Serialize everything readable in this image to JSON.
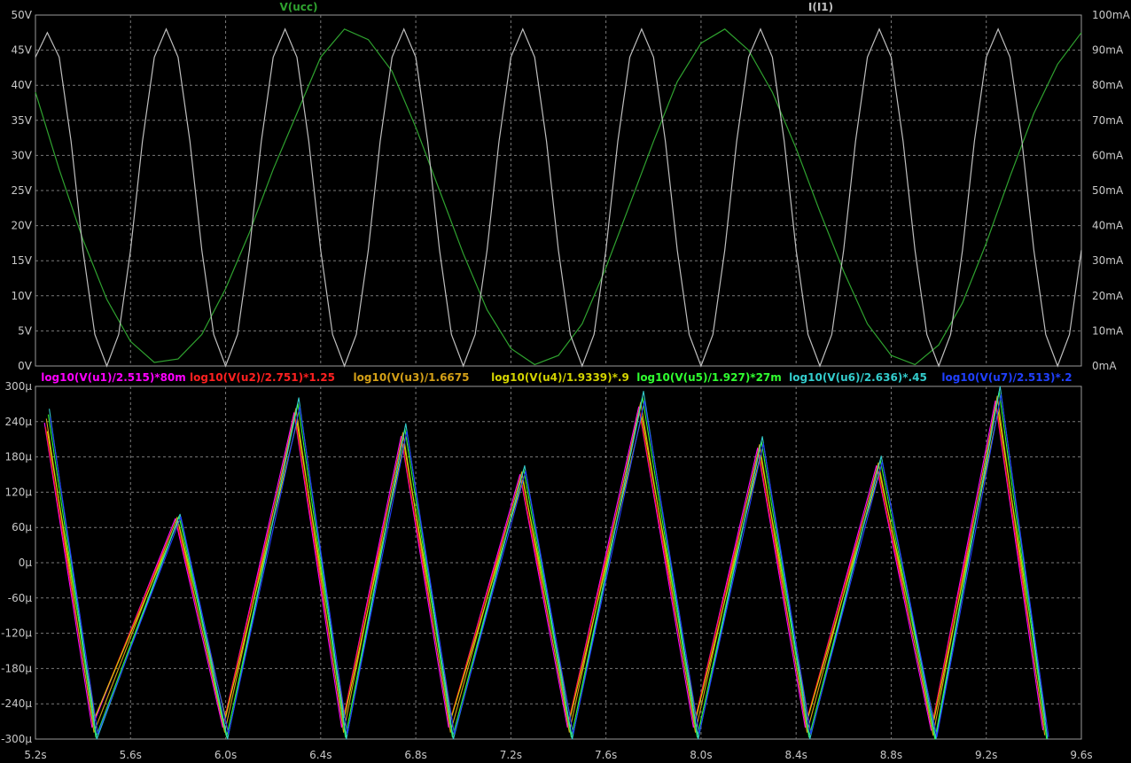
{
  "chart_data": [
    {
      "type": "line",
      "panel": "top",
      "xlim": [
        5.2,
        9.6
      ],
      "x_ticks": [
        "5.2s",
        "5.6s",
        "6.0s",
        "6.4s",
        "6.8s",
        "7.2s",
        "7.6s",
        "8.0s",
        "8.4s",
        "8.8s",
        "9.2s",
        "9.6s"
      ],
      "left_axis": {
        "ylim": [
          0,
          50
        ],
        "ticks": [
          "0V",
          "5V",
          "10V",
          "15V",
          "20V",
          "25V",
          "30V",
          "35V",
          "40V",
          "45V",
          "50V"
        ]
      },
      "right_axis": {
        "ylim": [
          0,
          100
        ],
        "ticks": [
          "0mA",
          "10mA",
          "20mA",
          "30mA",
          "40mA",
          "50mA",
          "60mA",
          "70mA",
          "80mA",
          "90mA",
          "100mA"
        ]
      },
      "grid": true,
      "series": [
        {
          "name": "V(ucc)",
          "color": "#2fa22f",
          "axis": "left",
          "x": [
            5.2,
            5.3,
            5.4,
            5.5,
            5.6,
            5.7,
            5.8,
            5.9,
            6.0,
            6.1,
            6.2,
            6.3,
            6.4,
            6.5,
            6.6,
            6.7,
            6.8,
            6.9,
            7.0,
            7.1,
            7.2,
            7.3,
            7.4,
            7.5,
            7.6,
            7.7,
            7.8,
            7.9,
            8.0,
            8.1,
            8.2,
            8.3,
            8.4,
            8.5,
            8.6,
            8.7,
            8.8,
            8.9,
            9.0,
            9.1,
            9.2,
            9.3,
            9.4,
            9.5,
            9.6
          ],
          "y": [
            39.0,
            28.0,
            18.0,
            9.5,
            3.5,
            0.5,
            1.0,
            4.5,
            11.0,
            19.0,
            28.0,
            36.0,
            44.0,
            48.0,
            46.5,
            42.0,
            34.0,
            25.0,
            16.0,
            8.0,
            2.5,
            0.2,
            1.5,
            6.0,
            14.0,
            23.0,
            32.0,
            40.5,
            46.0,
            48.0,
            45.0,
            39.0,
            31.0,
            22.0,
            13.5,
            6.0,
            1.5,
            0.2,
            3.0,
            9.0,
            17.5,
            27.0,
            36.0,
            43.0,
            47.5
          ]
        },
        {
          "name": "I(I1)",
          "color": "#bfbfbf",
          "axis": "right",
          "x": [
            5.2,
            5.25,
            5.3,
            5.35,
            5.4,
            5.45,
            5.5,
            5.55,
            5.6,
            5.65,
            5.7,
            5.75,
            5.8,
            5.85,
            5.9,
            5.95,
            6.0,
            6.05,
            6.1,
            6.15,
            6.2,
            6.25,
            6.3,
            6.35,
            6.4,
            6.45,
            6.5,
            6.55,
            6.6,
            6.65,
            6.7,
            6.75,
            6.8,
            6.85,
            6.9,
            6.95,
            7.0,
            7.05,
            7.1,
            7.15,
            7.2,
            7.25,
            7.3,
            7.35,
            7.4,
            7.45,
            7.5,
            7.55,
            7.6,
            7.65,
            7.7,
            7.75,
            7.8,
            7.85,
            7.9,
            7.95,
            8.0,
            8.05,
            8.1,
            8.15,
            8.2,
            8.25,
            8.3,
            8.35,
            8.4,
            8.45,
            8.5,
            8.55,
            8.6,
            8.65,
            8.7,
            8.75,
            8.8,
            8.85,
            8.9,
            8.95,
            9.0,
            9.05,
            9.1,
            9.15,
            9.2,
            9.25,
            9.3,
            9.35,
            9.4,
            9.45,
            9.5,
            9.55,
            9.6
          ],
          "y": [
            88,
            95,
            88,
            64,
            33,
            9,
            0,
            9,
            33,
            64,
            88,
            96,
            88,
            64,
            33,
            9,
            0,
            9,
            33,
            64,
            88,
            96,
            88,
            64,
            33,
            9,
            0,
            9,
            33,
            64,
            88,
            96,
            88,
            64,
            33,
            9,
            0,
            9,
            33,
            64,
            88,
            96,
            88,
            64,
            33,
            9,
            0,
            9,
            33,
            64,
            88,
            96,
            88,
            64,
            33,
            9,
            0,
            9,
            33,
            64,
            88,
            96,
            88,
            64,
            33,
            9,
            0,
            9,
            33,
            64,
            88,
            96,
            88,
            64,
            33,
            9,
            0,
            9,
            33,
            64,
            88,
            96,
            88,
            64,
            33,
            9,
            0,
            9,
            33
          ]
        }
      ]
    },
    {
      "type": "line",
      "panel": "bottom",
      "xlim": [
        5.2,
        9.6
      ],
      "x_ticks": [
        "5.2s",
        "5.6s",
        "6.0s",
        "6.4s",
        "6.8s",
        "7.2s",
        "7.6s",
        "8.0s",
        "8.4s",
        "8.8s",
        "9.2s",
        "9.6s"
      ],
      "ylim": [
        -300,
        300
      ],
      "y_ticks": [
        "-300µ",
        "-240µ",
        "-180µ",
        "-120µ",
        "-60µ",
        "0µ",
        "60µ",
        "120µ",
        "180µ",
        "240µ",
        "300µ"
      ],
      "grid": true,
      "peaks": {
        "x": [
          5.25,
          5.45,
          5.8,
          6.0,
          6.3,
          6.5,
          6.75,
          6.95,
          7.25,
          7.45,
          7.75,
          7.98,
          8.25,
          8.45,
          8.75,
          8.98,
          9.25,
          9.45
        ],
        "y": [
          238,
          -280,
          75,
          -280,
          255,
          -280,
          215,
          -280,
          150,
          -280,
          265,
          -280,
          195,
          -280,
          165,
          -285,
          275,
          -285
        ]
      },
      "series": [
        {
          "name": "log10(V(u1)/2.515)*80m",
          "color": "#ff00ff",
          "scale": 1.0
        },
        {
          "name": "log10(V(u2)/2.751)*1.25",
          "color": "#ff2020",
          "scale": 0.97
        },
        {
          "name": "log10(V(u3)/1.6675",
          "color": "#d4a017",
          "scale": 1.03
        },
        {
          "name": "log10(V(u4)/1.9339)*.9",
          "color": "#d4d400",
          "scale": 0.94
        },
        {
          "name": "log10(V(u5)/1.927)*27m",
          "color": "#30ff30",
          "scale": 1.06
        },
        {
          "name": "log10(V(u6)/2.636)*.45",
          "color": "#33cccc",
          "scale": 1.1
        },
        {
          "name": "log10(V(u7)/2.513)*.2",
          "color": "#2040ff",
          "scale": 1.04
        }
      ]
    }
  ]
}
